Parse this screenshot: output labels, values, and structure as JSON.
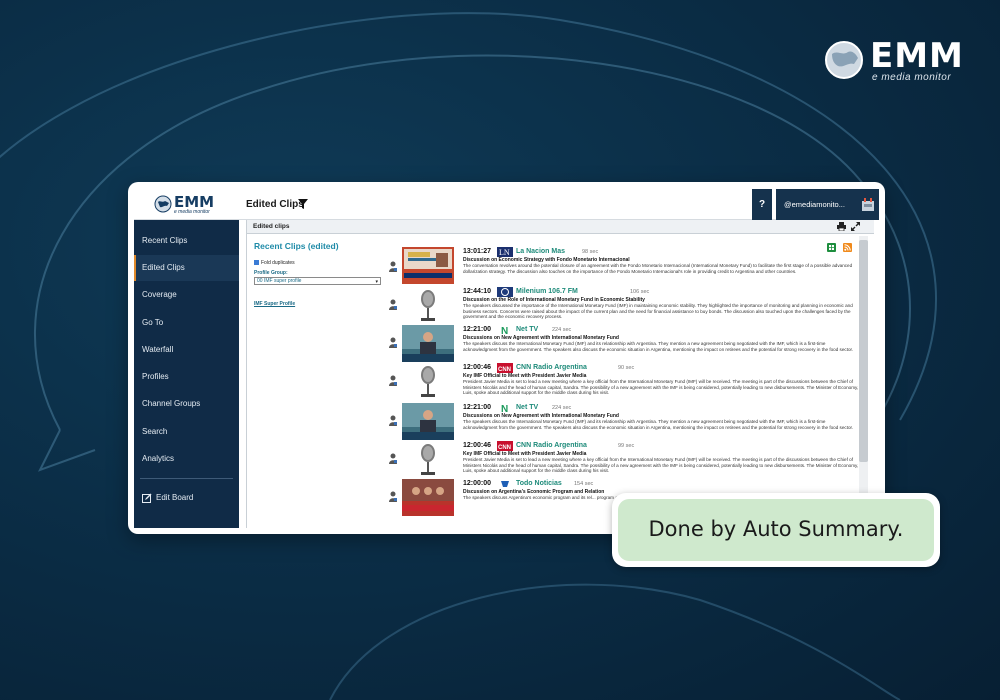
{
  "brand": {
    "name": "EMM",
    "tagline": "e media monitor"
  },
  "app": {
    "logo_word": "EMM",
    "logo_sub": "e media monitor",
    "page_title": "Edited Clips",
    "help_label": "?",
    "user_name": "@emediamonito..."
  },
  "sidebar": {
    "items": [
      {
        "label": "Recent Clips",
        "active": false
      },
      {
        "label": "Edited Clips",
        "active": true
      },
      {
        "label": "Coverage",
        "active": false
      },
      {
        "label": "Go To",
        "active": false
      },
      {
        "label": "Waterfall",
        "active": false
      },
      {
        "label": "Profiles",
        "active": false
      },
      {
        "label": "Channel Groups",
        "active": false
      },
      {
        "label": "Search",
        "active": false
      },
      {
        "label": "Analytics",
        "active": false
      }
    ],
    "edit_board": "Edit Board"
  },
  "panel": {
    "title": "Edited clips",
    "section_title": "Recent Clips (edited)",
    "fold_label": "Fold duplicates",
    "profile_group_label": "Profile Group:",
    "profile_group_value": "00 IMF super profile",
    "profile_link": "IMF Super Profile"
  },
  "clips": [
    {
      "time": "13:01:27",
      "channel": "La Nacion Mas",
      "duration": "98 sec",
      "thumb": "tv-news",
      "headline": "Discussion on Economic Strategy with Fondo Monetario Internacional",
      "summary": "The conversation revolves around the potential closure of an agreement with the Fondo Monetario Internacional (International Monetary Fund) to facilitate the first stage of a possible advanced dollarization strategy. The discussion also touches on the importance of the Fondo Monetario Internacional's role in providing credit to Argentina and other countries."
    },
    {
      "time": "12:44:10",
      "channel": "Milenium 106.7 FM",
      "duration": "106 sec",
      "thumb": "microphone",
      "headline": "Discussion on the Role of International Monetary Fund in Economic Stability",
      "summary": "The speakers discussed the importance of the International Monetary Fund (IMF) in maintaining economic stability. They highlighted the importance of monitoring and planning in economic and business sectors. Concerns were raised about the impact of the current plan and the need for financial assistance to buy bonds. The discussion also touched upon the challenges faced by the government and the economic recovery process."
    },
    {
      "time": "12:21:00",
      "channel": "Net TV",
      "duration": "224 sec",
      "thumb": "tv-studio",
      "headline": "Discussions on New Agreement with International Monetary Fund",
      "summary": "The speakers discuss the International Monetary Fund (IMF) and its relationship with Argentina. They mention a new agreement being negotiated with the IMF, which is a first-time acknowledgment from the government. The speakers also discuss the economic situation in Argentina, mentioning the impact on retirees and the potential for strong recovery in the food sector."
    },
    {
      "time": "12:00:46",
      "channel": "CNN Radio Argentina",
      "duration": "90 sec",
      "thumb": "microphone",
      "headline": "Key IMF Official to Meet with President Javier Media",
      "summary": "President Javier Media is set to lead a new meeting where a key official from the International Monetary Fund (IMF) will be received. The meeting is part of the discussions between the Chief of Ministers Nicolás and the head of human capital, Sandra. The possibility of a new agreement with the IMF is being considered, potentially leading to new disbursements. The Minister of Economy, Luis, spoke about additional support for the middle class during his visit."
    },
    {
      "time": "12:21:00",
      "channel": "Net TV",
      "duration": "224 sec",
      "thumb": "tv-studio",
      "headline": "Discussions on New Agreement with International Monetary Fund",
      "summary": "The speakers discuss the International Monetary Fund (IMF) and its relationship with Argentina. They mention a new agreement being negotiated with the IMF, which is a first-time acknowledgment from the government. The speakers also discuss the economic situation in Argentina, mentioning the impact on retirees and the potential for strong recovery in the food sector."
    },
    {
      "time": "12:00:46",
      "channel": "CNN Radio Argentina",
      "duration": "99 sec",
      "thumb": "microphone",
      "headline": "Key IMF Official to Meet with President Javier Media",
      "summary": "President Javier Media is set to lead a new meeting where a key official from the International Monetary Fund (IMF) will be received. The meeting is part of the discussions between the Chief of Ministers Nicolás and the head of human capital, Sandra. The possibility of a new agreement with the IMF is being considered, potentially leading to new disbursements. The Minister of Economy, Luis, spoke about additional support for the middle class during his visit."
    },
    {
      "time": "12:00:00",
      "channel": "Todo Noticias",
      "duration": "154 sec",
      "thumb": "tv-panel",
      "headline": "Discussion on Argentina's Economic Program and Relation",
      "summary": "The speakers discuss Argentina's economic program and its rel... program and the challenges it poses both socially and economi..."
    }
  ],
  "badge": {
    "text": "Done by Auto Summary."
  },
  "colors": {
    "navy": "#102b47",
    "teal": "#1f8ba8",
    "accent_orange": "#e08a2b",
    "badge_green": "#cfe9cd"
  }
}
